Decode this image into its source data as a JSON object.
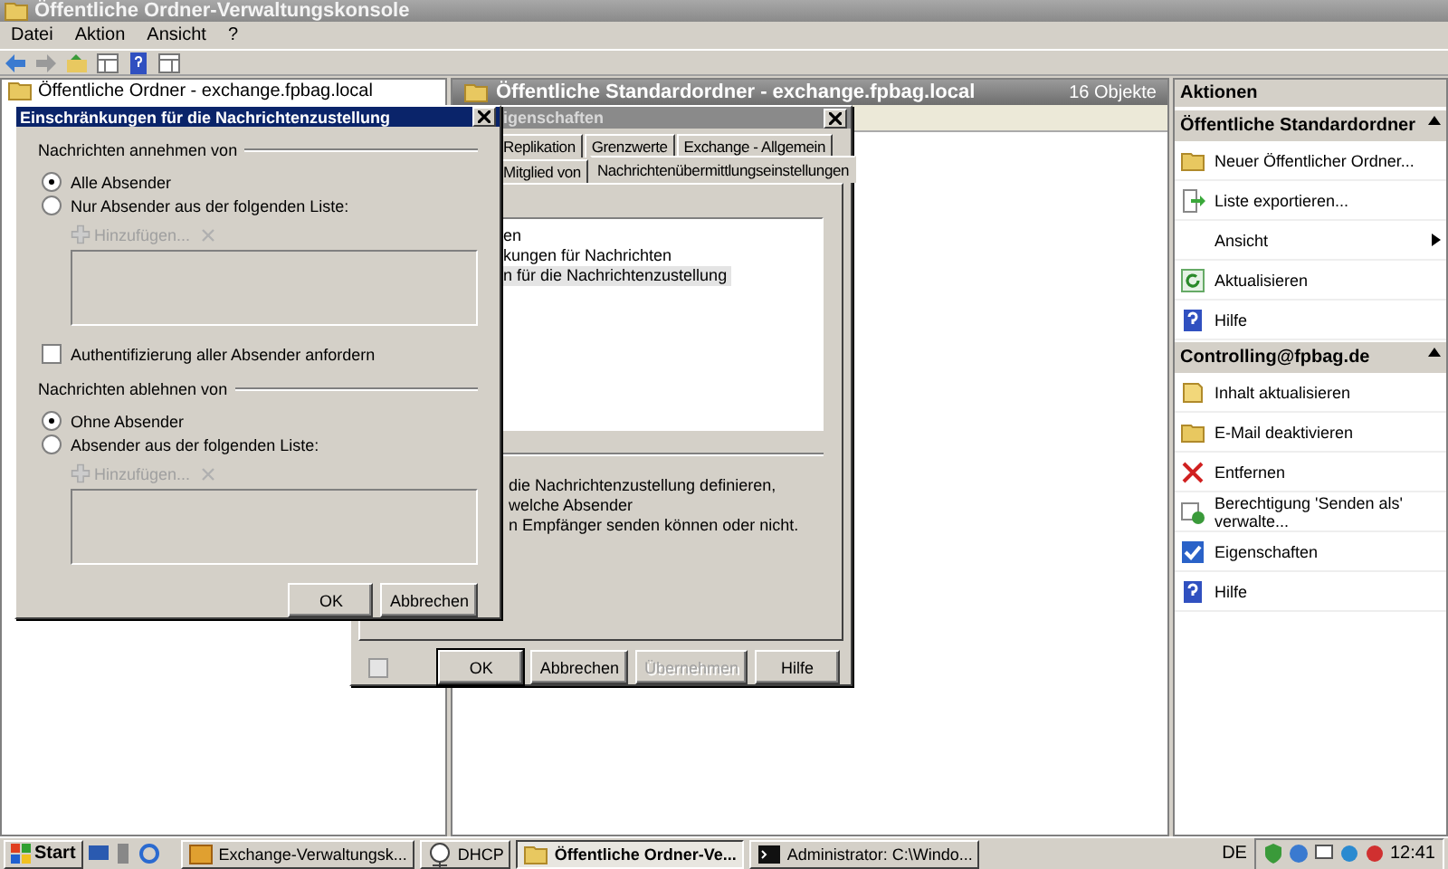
{
  "main_window": {
    "title": "Öffentliche Ordner-Verwaltungskonsole",
    "menu": [
      "Datei",
      "Aktion",
      "Ansicht",
      "?"
    ],
    "tree": {
      "label": "Öffentliche Ordner - exchange.fpbag.local"
    },
    "results": {
      "title": "Öffentliche Standardordner - exchange.fpbag.local",
      "count": "16 Objekte"
    },
    "actions": {
      "title": "Aktionen",
      "sections": [
        {
          "title": "Öffentliche Standardordner",
          "items": [
            {
              "kind": "folder",
              "label": "Neuer Öffentlicher Ordner..."
            },
            {
              "kind": "export",
              "label": "Liste exportieren..."
            },
            {
              "kind": "submenu",
              "label": "Ansicht"
            },
            {
              "kind": "refresh",
              "label": "Aktualisieren"
            },
            {
              "kind": "help",
              "label": "Hilfe"
            }
          ]
        },
        {
          "title": "Controlling@fpbag.de",
          "items": [
            {
              "kind": "note",
              "label": "Inhalt aktualisieren"
            },
            {
              "kind": "folder",
              "label": "E-Mail deaktivieren"
            },
            {
              "kind": "delete",
              "label": "Entfernen"
            },
            {
              "kind": "permission",
              "label": "Berechtigung 'Senden als' verwalte..."
            },
            {
              "kind": "properties",
              "label": "Eigenschaften"
            },
            {
              "kind": "help",
              "label": "Hilfe"
            }
          ]
        }
      ]
    }
  },
  "properties_dialog": {
    "title": "igenschaften",
    "tab_rows": [
      [
        {
          "label": "Replikation",
          "selected": false
        },
        {
          "label": "Grenzwerte",
          "selected": false
        },
        {
          "label": "Exchange - Allgemein",
          "selected": false
        }
      ],
      [
        {
          "label": "Mitglied von",
          "selected": false
        },
        {
          "label": "Nachrichtenübermittlungseinstellungen",
          "selected": true
        }
      ]
    ],
    "list": [
      {
        "label": "en",
        "selected": false
      },
      {
        "label": "kungen für Nachrichten",
        "selected": false
      },
      {
        "label": "n für die Nachrichtenzustellung",
        "selected": true
      }
    ],
    "description": [
      "die Nachrichtenzustellung definieren, welche Absender",
      "n Empfänger senden können oder nicht."
    ],
    "buttons": [
      {
        "label": "OK",
        "disabled": false
      },
      {
        "label": "Abbrechen",
        "disabled": false
      },
      {
        "label": "Übernehmen",
        "disabled": true
      },
      {
        "label": "Hilfe",
        "disabled": false
      }
    ]
  },
  "restrictions_dialog": {
    "title": "Einschränkungen für die Nachrichtenzustellung",
    "accept": {
      "title": "Nachrichten annehmen von",
      "options": [
        {
          "label": "Alle Absender",
          "selected": true
        },
        {
          "label": "Nur Absender aus der folgenden Liste:",
          "selected": false
        }
      ],
      "add_button": {
        "label": "Hinzufügen...",
        "disabled": true
      }
    },
    "auth_checkbox": {
      "label": "Authentifizierung aller Absender anfordern",
      "checked": false
    },
    "reject": {
      "title": "Nachrichten ablehnen von",
      "options": [
        {
          "label": "Ohne Absender",
          "selected": true
        },
        {
          "label": "Absender aus der folgenden Liste:",
          "selected": false
        }
      ],
      "add_button": {
        "label": "Hinzufügen...",
        "disabled": true
      }
    },
    "buttons": [
      {
        "label": "OK",
        "disabled": false
      },
      {
        "label": "Abbrechen",
        "disabled": false
      }
    ]
  },
  "taskbar": {
    "start": "Start",
    "tasks": [
      {
        "label": "Exchange-Verwaltungsk...",
        "kind": "exchange",
        "selected": false
      },
      {
        "label": "DHCP",
        "kind": "dhcp",
        "selected": false
      },
      {
        "label": "Öffentliche Ordner-Ve...",
        "kind": "folder",
        "selected": true
      },
      {
        "label": "Administrator: C:\\Windo...",
        "kind": "console",
        "selected": false
      }
    ],
    "language": "DE",
    "clock": "12:41"
  }
}
